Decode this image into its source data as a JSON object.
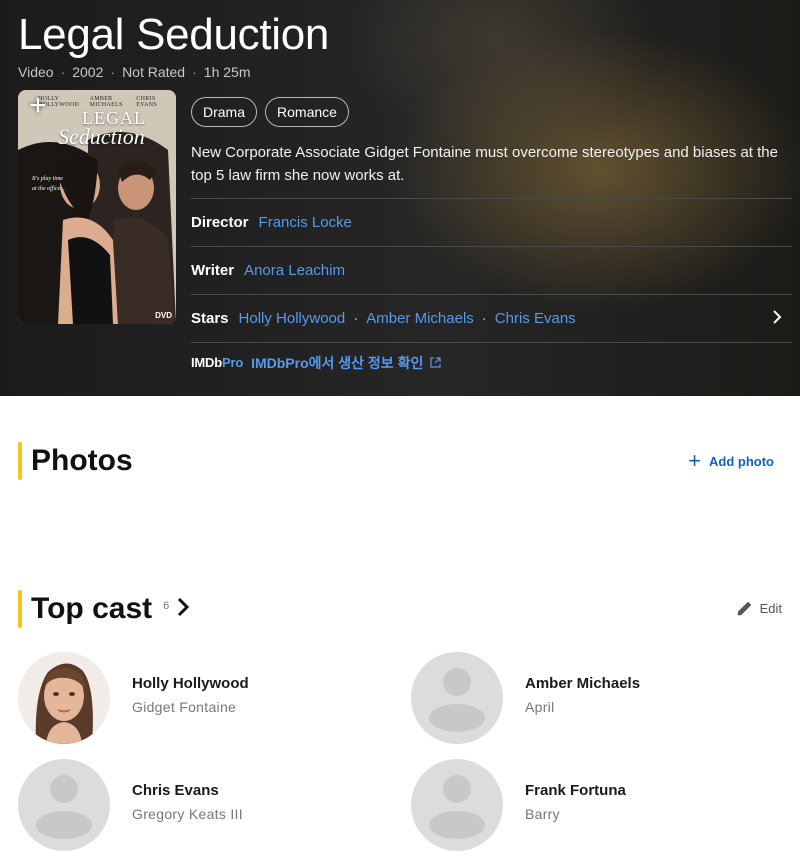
{
  "title": {
    "name": "Legal Seduction",
    "meta": [
      "Video",
      "2002",
      "Not Rated",
      "1h 25m"
    ]
  },
  "poster": {
    "add_icon": "plus-icon",
    "names": [
      "HOLLY HOLLYWOOD",
      "AMBER MICHAELS",
      "CHRIS EVANS"
    ],
    "title_line1": "LEGAL",
    "title_line2": "Seduction",
    "tagline": [
      "It's play time",
      "at the office..."
    ],
    "dvd": "DVD"
  },
  "genres": [
    "Drama",
    "Romance"
  ],
  "plot": "New Corporate Associate Gidget Fontaine must overcome stereotypes and biases at the top 5 law firm she now works at.",
  "credits": {
    "director_label": "Director",
    "director": "Francis Locke",
    "writer_label": "Writer",
    "writer": "Anora Leachim",
    "stars_label": "Stars",
    "stars": [
      "Holly Hollywood",
      "Amber Michaels",
      "Chris Evans"
    ]
  },
  "imdbpro": {
    "logo_a": "IMDb",
    "logo_b": "Pro",
    "link": "IMDbPro에서 생산 정보 확인"
  },
  "photos": {
    "title": "Photos",
    "add_label": "Add photo"
  },
  "top_cast": {
    "title": "Top cast",
    "count": "6",
    "edit_label": "Edit",
    "members": [
      {
        "actor": "Holly Hollywood",
        "character": "Gidget Fontaine",
        "has_photo": true
      },
      {
        "actor": "Amber Michaels",
        "character": "April",
        "has_photo": false
      },
      {
        "actor": "Chris Evans",
        "character": "Gregory Keats III",
        "has_photo": false
      },
      {
        "actor": "Frank Fortuna",
        "character": "Barry",
        "has_photo": false
      }
    ]
  },
  "colors": {
    "accent": "#f5c518",
    "link_dark": "#5799ef",
    "link_light": "#0e63be"
  }
}
